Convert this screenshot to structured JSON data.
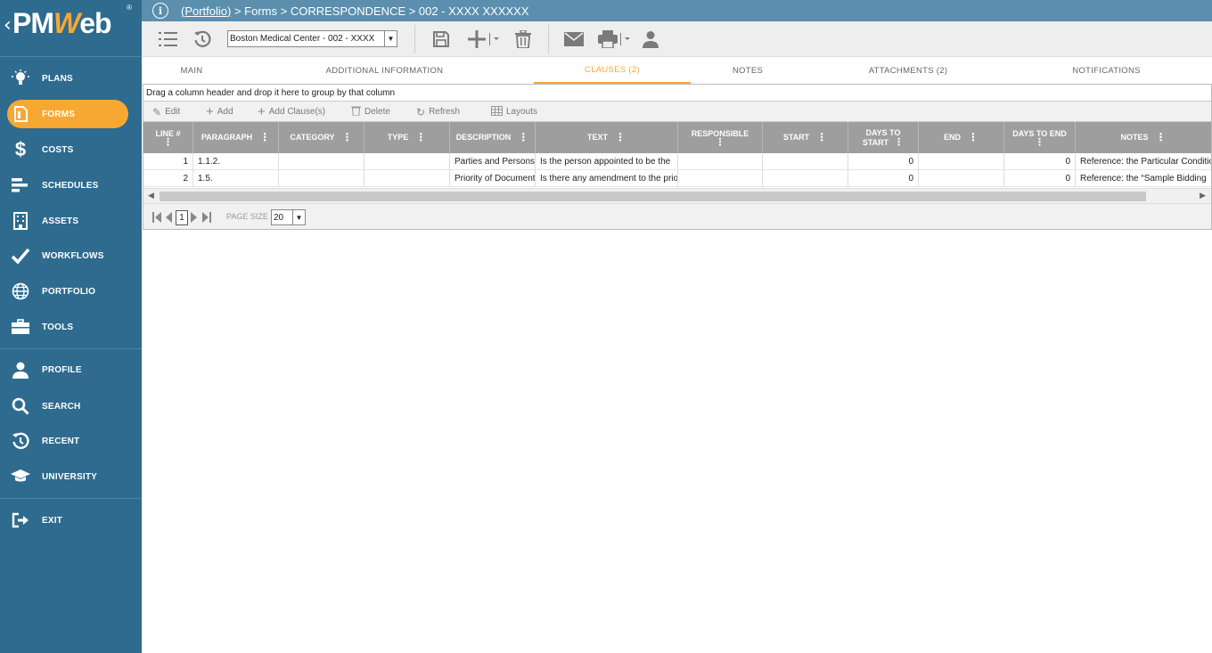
{
  "app": {
    "logo_text": "PMWeb",
    "registered_mark": "®",
    "accent_color": "#f7a833",
    "sidebar_color": "#2e6b8f"
  },
  "breadcrumb": {
    "portfolio_link": "(Portfolio)",
    "rest": " > Forms > CORRESPONDENCE > 002 - XXXX XXXXXX"
  },
  "sidebar": {
    "items": [
      {
        "label": "PLANS",
        "icon": "lightbulb-icon"
      },
      {
        "label": "FORMS",
        "icon": "document-icon",
        "active": true
      },
      {
        "label": "COSTS",
        "icon": "dollar-icon"
      },
      {
        "label": "SCHEDULES",
        "icon": "gantt-icon"
      },
      {
        "label": "ASSETS",
        "icon": "building-icon"
      },
      {
        "label": "WORKFLOWS",
        "icon": "checkmark-icon"
      },
      {
        "label": "PORTFOLIO",
        "icon": "globe-icon"
      },
      {
        "label": "TOOLS",
        "icon": "toolbox-icon"
      },
      {
        "label": "PROFILE",
        "icon": "person-icon"
      },
      {
        "label": "SEARCH",
        "icon": "search-icon"
      },
      {
        "label": "RECENT",
        "icon": "history-icon"
      },
      {
        "label": "UNIVERSITY",
        "icon": "graduation-cap-icon"
      },
      {
        "label": "EXIT",
        "icon": "exit-icon"
      }
    ]
  },
  "toolbar": {
    "project_select": "Boston Medical Center - 002 - XXXX"
  },
  "tabs": [
    {
      "label": "MAIN"
    },
    {
      "label": "ADDITIONAL INFORMATION"
    },
    {
      "label": "CLAUSES (2)",
      "active": true
    },
    {
      "label": "NOTES"
    },
    {
      "label": "ATTACHMENTS (2)"
    },
    {
      "label": "NOTIFICATIONS"
    }
  ],
  "grid": {
    "group_hint": "Drag a column header and drop it here to group by that column",
    "toolbar": {
      "edit": "Edit",
      "add": "Add",
      "add_clauses": "Add Clause(s)",
      "delete": "Delete",
      "refresh": "Refresh",
      "layouts": "Layouts"
    },
    "columns": [
      {
        "l1": "LINE #",
        "l2": ""
      },
      {
        "l1": "PARAGRAPH",
        "l2": ""
      },
      {
        "l1": "CATEGORY",
        "l2": ""
      },
      {
        "l1": "TYPE",
        "l2": ""
      },
      {
        "l1": "DESCRIPTION",
        "l2": ""
      },
      {
        "l1": "TEXT",
        "l2": ""
      },
      {
        "l1": "RESPONSIBLE",
        "l2": ""
      },
      {
        "l1": "START",
        "l2": ""
      },
      {
        "l1": "DAYS TO",
        "l2": "START"
      },
      {
        "l1": "END",
        "l2": ""
      },
      {
        "l1": "DAYS TO END",
        "l2": ""
      },
      {
        "l1": "NOTES",
        "l2": ""
      }
    ],
    "rows": [
      {
        "line": "1",
        "paragraph": "1.1.2.",
        "category": "",
        "type": "",
        "description": "Parties and Persons",
        "text": "Is the person appointed to be the",
        "responsible": "",
        "start": "",
        "days_to_start": "0",
        "end": "",
        "days_to_end": "0",
        "notes": "Reference: the Particular Conditions"
      },
      {
        "line": "2",
        "paragraph": "1.5.",
        "category": "",
        "type": "",
        "description": "Priority of Documents",
        "text": "Is there any amendment to the priority",
        "responsible": "",
        "start": "",
        "days_to_start": "0",
        "end": "",
        "days_to_end": "0",
        "notes": "Reference: the “Sample Bidding"
      }
    ],
    "pager": {
      "page": "1",
      "page_size_label": "PAGE SIZE",
      "page_size": "20"
    }
  }
}
